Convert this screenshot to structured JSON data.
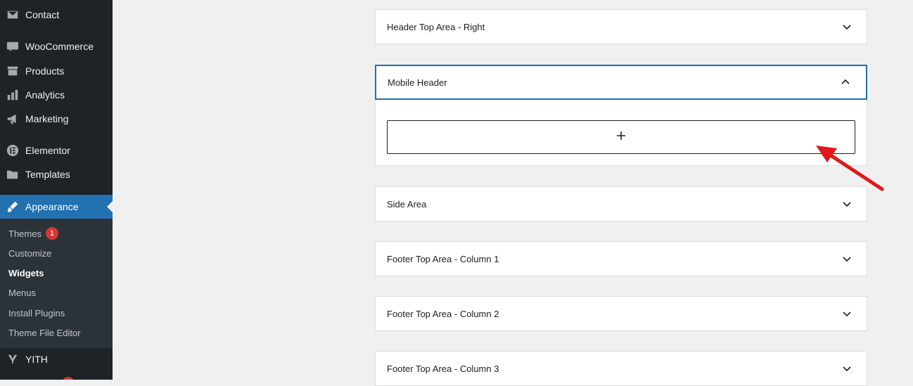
{
  "sidebar": {
    "menu": [
      {
        "label": "Contact",
        "icon": "mail-icon"
      },
      {
        "label": "WooCommerce",
        "icon": "woocommerce-icon"
      },
      {
        "label": "Products",
        "icon": "archive-icon"
      },
      {
        "label": "Analytics",
        "icon": "bar-chart-icon"
      },
      {
        "label": "Marketing",
        "icon": "megaphone-icon"
      },
      {
        "label": "Elementor",
        "icon": "elementor-icon"
      },
      {
        "label": "Templates",
        "icon": "folder-icon"
      },
      {
        "label": "Appearance",
        "icon": "paintbrush-icon"
      },
      {
        "label": "YITH",
        "icon": "yith-icon"
      }
    ],
    "submenu": [
      {
        "label": "Themes",
        "badge": "1"
      },
      {
        "label": "Customize"
      },
      {
        "label": "Widgets",
        "current": true
      },
      {
        "label": "Menus"
      },
      {
        "label": "Install Plugins"
      },
      {
        "label": "Theme File Editor"
      }
    ]
  },
  "widget_areas": [
    {
      "label": "Header Top Area - Right",
      "state": "collapsed"
    },
    {
      "label": "Mobile Header",
      "state": "expanded"
    },
    {
      "label": "Side Area",
      "state": "collapsed"
    },
    {
      "label": "Footer Top Area - Column 1",
      "state": "collapsed"
    },
    {
      "label": "Footer Top Area - Column 2",
      "state": "collapsed"
    },
    {
      "label": "Footer Top Area - Column 3",
      "state": "collapsed"
    }
  ],
  "add_block": {
    "label": "+",
    "icon": "plus-icon"
  },
  "annotation": {
    "color": "#e0191a",
    "icon": "red-arrow-icon"
  }
}
